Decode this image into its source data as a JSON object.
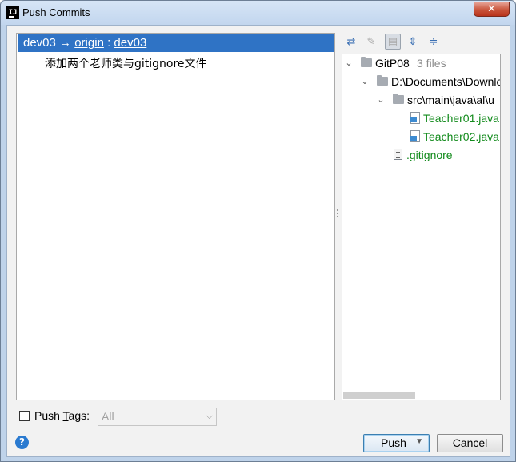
{
  "window": {
    "title": "Push Commits",
    "app_icon": "IJ",
    "close_glyph": "✕"
  },
  "commits": {
    "branch_local": "dev03",
    "arrow": "→",
    "remote": "origin",
    "separator": ":",
    "branch_remote": "dev03",
    "items": [
      {
        "message": "添加两个老师类与gitignore文件"
      }
    ]
  },
  "toolbar": {
    "icons": [
      "arrows-collapse-icon",
      "edit-source-icon",
      "group-by-directory-icon",
      "expand-all-icon",
      "collapse-all-icon"
    ]
  },
  "tree": {
    "root": {
      "label": "GitP08",
      "count": "3 files"
    },
    "dir": "D:\\Documents\\Downloads",
    "subdir": "src\\main\\java\\al\\u",
    "files": [
      "Teacher01.java",
      "Teacher02.java"
    ],
    "gitignore": ".gitignore"
  },
  "footer": {
    "push_tags_label": "Push ",
    "push_tags_mnemonic": "T",
    "push_tags_rest": "ags:",
    "push_tags_checked": false,
    "tags_select_value": "All",
    "help_glyph": "?",
    "push_label": "Push",
    "cancel_label": "Cancel"
  },
  "colors": {
    "selection": "#2f73c5",
    "added_file": "#118a1b",
    "title_bg": "#c2d6ee",
    "close": "#c9543b"
  }
}
